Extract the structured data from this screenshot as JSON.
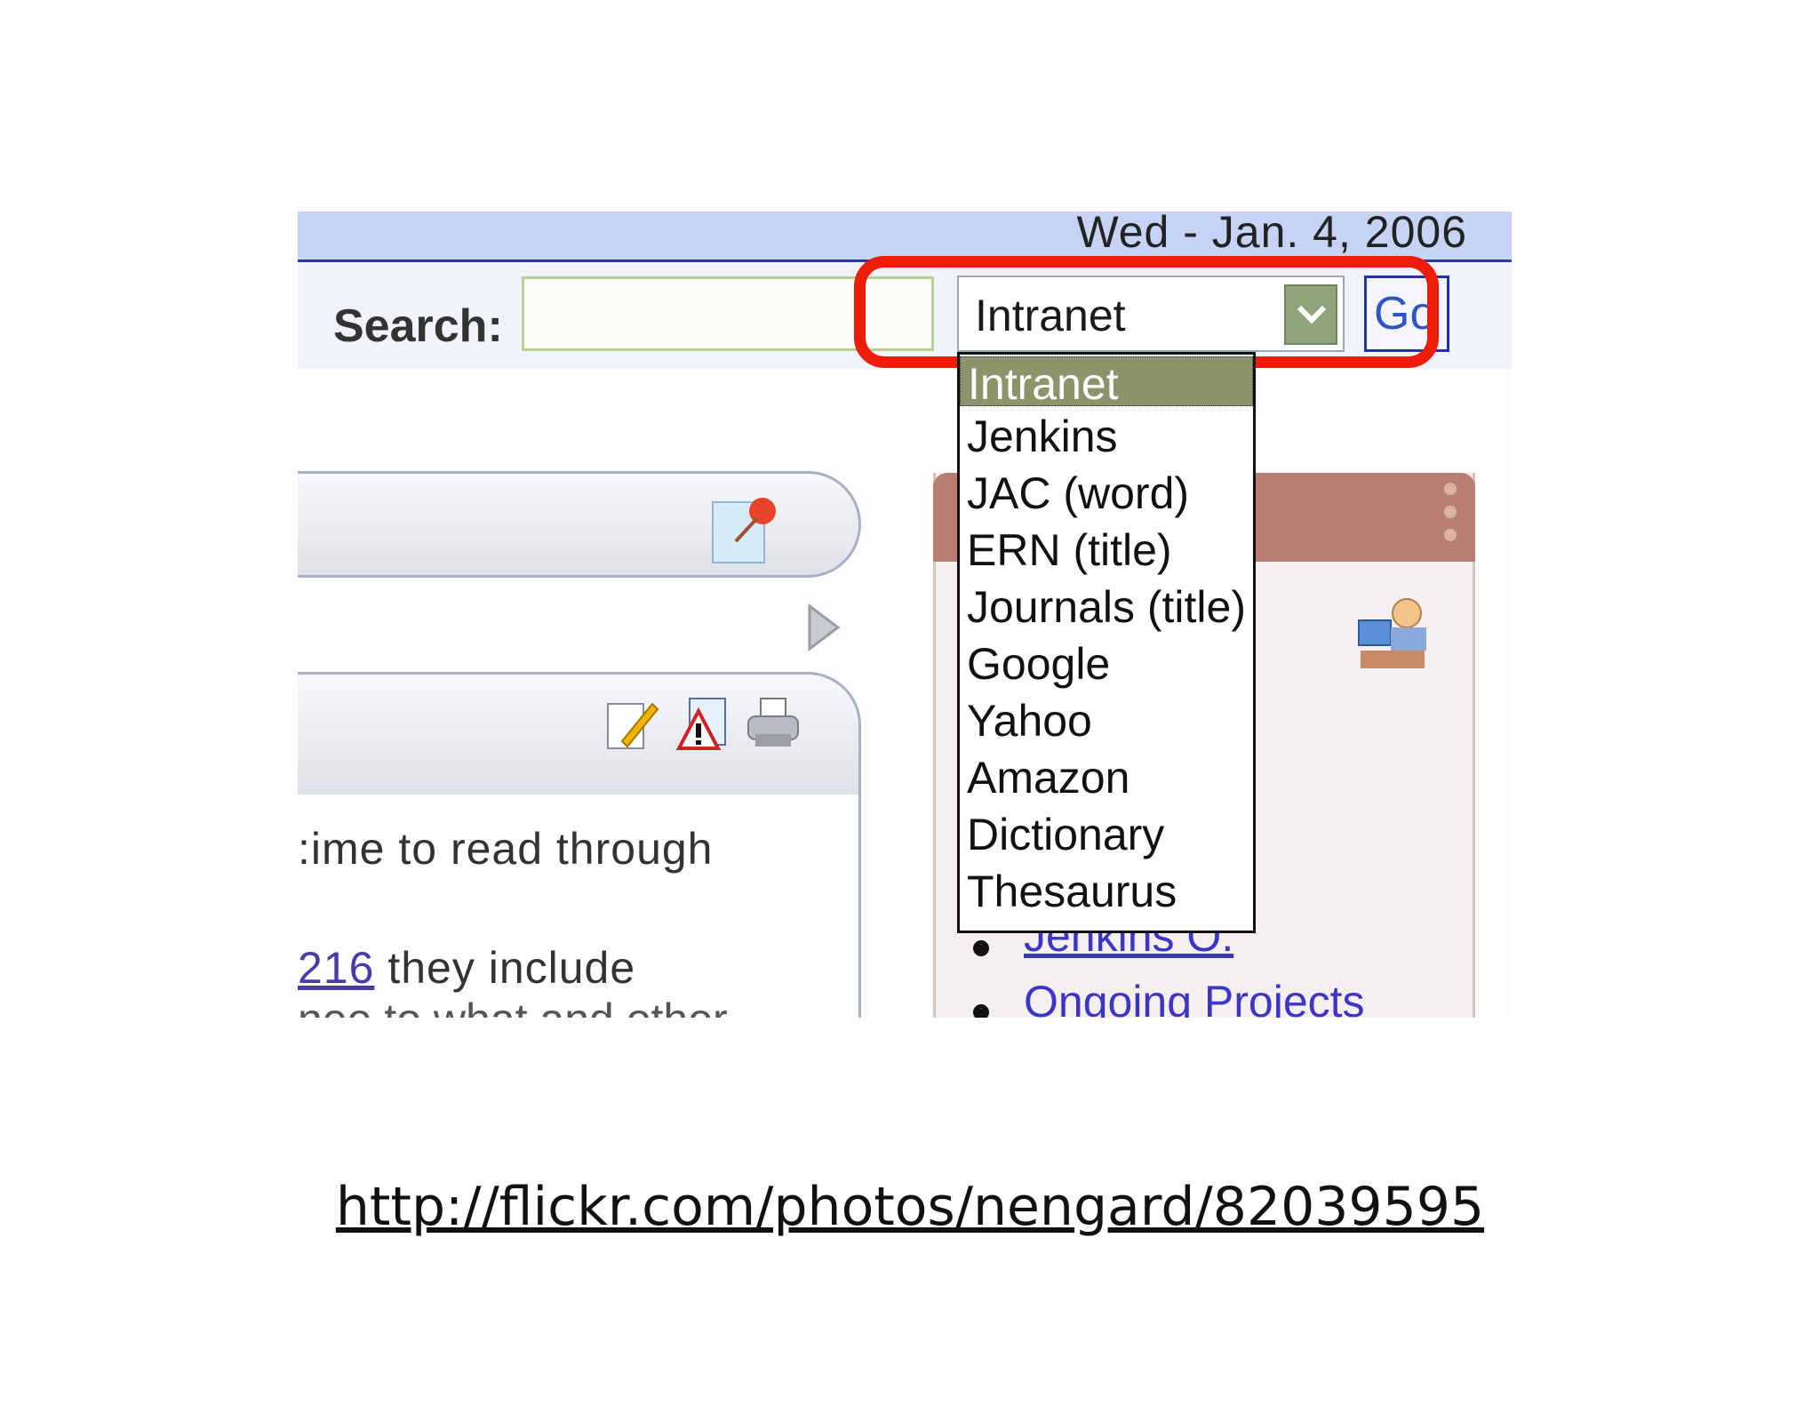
{
  "header": {
    "date": "Wed - Jan. 4, 2006"
  },
  "search": {
    "label": "Search:",
    "input_value": "",
    "selected": "Intranet",
    "go_label": "Go"
  },
  "dropdown": {
    "options": [
      "Intranet",
      "Jenkins",
      "JAC (word)",
      "ERN (title)",
      "Journals (title)",
      "Google",
      "Yahoo",
      "Amazon",
      "Dictionary",
      "Thesaurus"
    ]
  },
  "content": {
    "line1": ":ime to read through",
    "link": "216",
    "line2_rest": " they include",
    "line3": "nee to what and other"
  },
  "right_panel": {
    "links": [
      "Jenkins O.",
      "Ongoing Projects"
    ]
  },
  "caption": "http://flickr.com/photos/nengard/82039595",
  "colors": {
    "highlight": "#ee1c0a",
    "date_bar": "#c7d3f5",
    "selected_option": "#8b946a",
    "panel_header": "#b87e72"
  },
  "icons": [
    "pushpin-icon",
    "arrow-right-icon",
    "edit-icon",
    "report-icon",
    "print-icon",
    "people-icon",
    "chevron-down-icon"
  ]
}
